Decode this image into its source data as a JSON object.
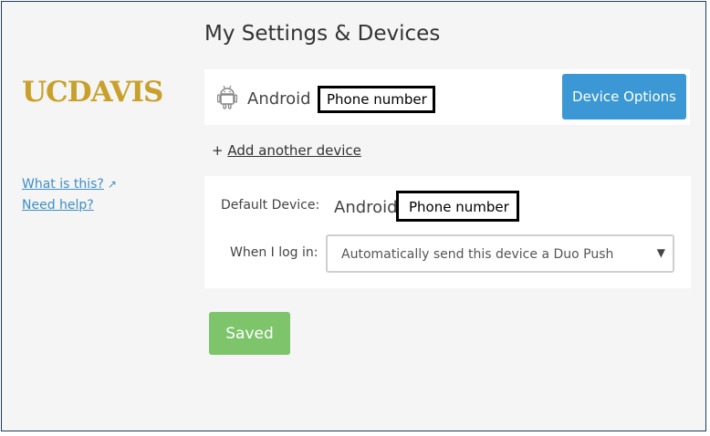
{
  "logo_text": "UCDAVIS",
  "page_title": "My Settings & Devices",
  "device": {
    "icon": "android-icon",
    "name": "Android",
    "phone_redaction": "Phone number",
    "options_button": "Device Options"
  },
  "add_device": {
    "prefix": "+",
    "link": "Add another device"
  },
  "sidebar": {
    "what_is_this": "What is this?",
    "need_help": "Need help?"
  },
  "default_device": {
    "label": "Default Device:",
    "device_name": "Android",
    "phone_redaction": "Phone number"
  },
  "login": {
    "label": "When I log in:",
    "selected_option": "Automatically send this device a Duo Push"
  },
  "saved_button": "Saved",
  "colors": {
    "brand": "#c8a02a",
    "primary": "#3b98d4",
    "success": "#7dc46b",
    "link": "#3e8ec4"
  }
}
